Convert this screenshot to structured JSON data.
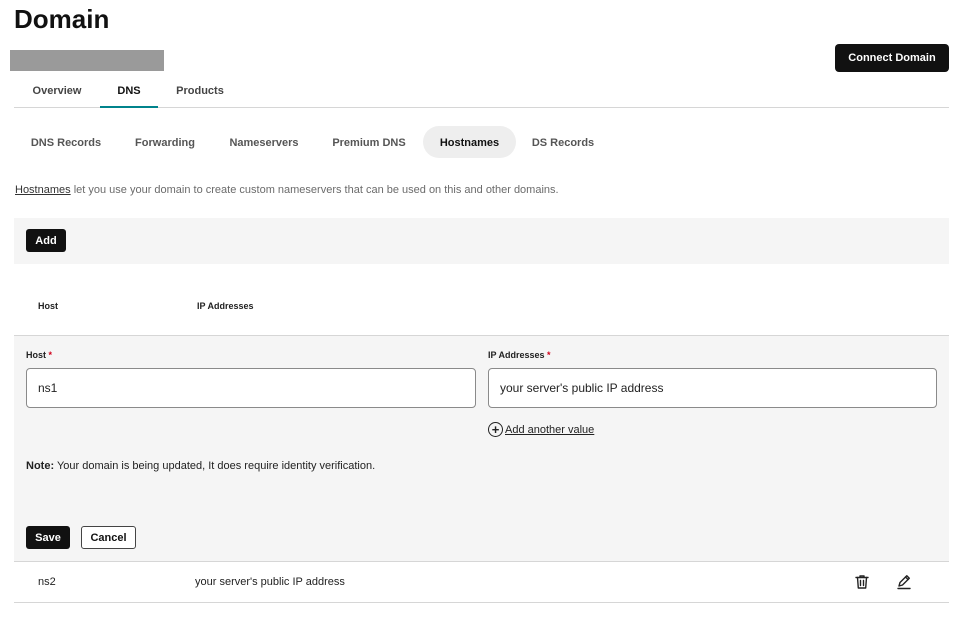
{
  "header": {
    "title": "Domain",
    "connect_label": "Connect Domain"
  },
  "main_tabs": [
    {
      "label": "Overview",
      "active": false
    },
    {
      "label": "DNS",
      "active": true
    },
    {
      "label": "Products",
      "active": false
    }
  ],
  "sub_tabs": [
    {
      "label": "DNS Records",
      "active": false
    },
    {
      "label": "Forwarding",
      "active": false
    },
    {
      "label": "Nameservers",
      "active": false
    },
    {
      "label": "Premium DNS",
      "active": false
    },
    {
      "label": "Hostnames",
      "active": true
    },
    {
      "label": "DS Records",
      "active": false
    }
  ],
  "intro": {
    "link": "Hostnames",
    "text": " let you use your domain to create custom nameservers that can be used on this and other domains."
  },
  "toolbar": {
    "add_label": "Add"
  },
  "table": {
    "columns": [
      "Host",
      "IP Addresses"
    ]
  },
  "edit_form": {
    "host_label": "Host",
    "ip_label": "IP Addresses",
    "required_mark": "*",
    "host_value": "ns1",
    "ip_value": "your server's public IP address",
    "add_another_label": "Add another value",
    "note_label": "Note:",
    "note_text": " Your domain is being updated, It does require identity verification.",
    "save_label": "Save",
    "cancel_label": "Cancel"
  },
  "rows": [
    {
      "host": "ns2",
      "ip": "your server's public IP address"
    }
  ],
  "icons": {
    "delete": "trash-icon",
    "edit": "pencil-icon",
    "add_value": "plus-circle-icon"
  },
  "colors": {
    "accent": "#00838c",
    "primary_button": "#111111",
    "required": "#d0021b",
    "panel_bg": "#f5f5f5"
  }
}
